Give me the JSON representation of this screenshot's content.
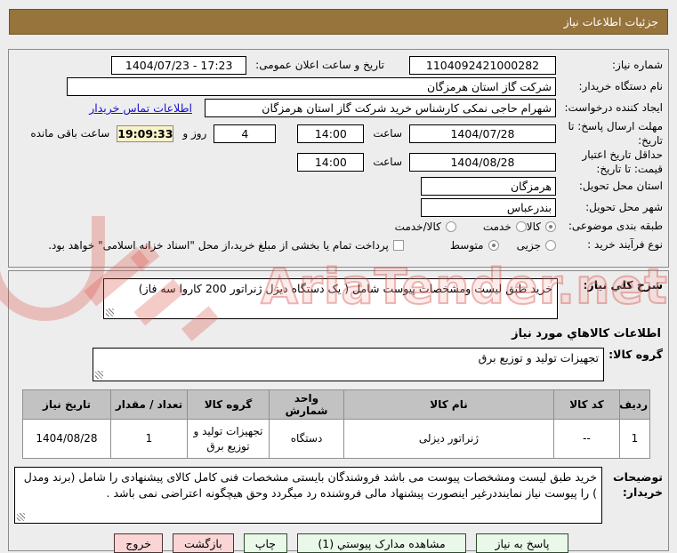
{
  "window": {
    "title": "جزئیات اطلاعات نیاز"
  },
  "watermark": {
    "text": "AriaTender.net"
  },
  "form": {
    "need_number": {
      "label": "شماره نیاز:",
      "value": "1104092421000282"
    },
    "announce": {
      "label": "تاریخ و ساعت اعلان عمومی:",
      "value": "1404/07/23 - 17:23"
    },
    "buyer_org": {
      "label": "نام دستگاه خریدار:",
      "value": "شرکت گاز استان هرمزگان"
    },
    "creator": {
      "label": "ایجاد کننده درخواست:",
      "value": "شهرام حاجی نمکی کارشناس خرید شرکت گاز استان هرمزگان",
      "contact_link": "اطلاعات تماس خریدار"
    },
    "deadline": {
      "label": "مهلت ارسال پاسخ: تا تاریخ:",
      "date": "1404/07/28",
      "hour_label": "ساعت",
      "time": "14:00",
      "days": "4",
      "days_label": "روز و",
      "countdown": "19:09:33",
      "remaining_label": "ساعت باقی مانده"
    },
    "price_validity": {
      "label": "حداقل تاریخ اعتبار قیمت: تا تاریخ:",
      "date": "1404/08/28",
      "hour_label": "ساعت",
      "time": "14:00"
    },
    "province": {
      "label": "استان محل تحویل:",
      "value": "هرمزگان"
    },
    "city": {
      "label": "شهر محل تحویل:",
      "value": "بندرعباس"
    },
    "subject_class": {
      "label": "طبقه بندی موضوعی:",
      "options": [
        {
          "label": "کالا",
          "selected": true
        },
        {
          "label": "خدمت",
          "selected": false
        },
        {
          "label": "کالا/خدمت",
          "selected": false
        }
      ]
    },
    "process": {
      "label": "نوع فرآیند خرید :",
      "options": [
        {
          "label": "جزیی",
          "selected": false
        },
        {
          "label": "متوسط",
          "selected": true
        }
      ],
      "treasury_note": "پرداخت تمام یا بخشی از مبلغ خرید،از محل \"اسناد خزانه اسلامی\" خواهد بود.",
      "treasury_checked": false
    }
  },
  "description": {
    "label": "شرح کلي نیاز:",
    "value": "خرید طبق لیست ومشخصات پیوست شامل ( یک دستگاه دیزل ژنراتور 200 کاروا سه فاز)"
  },
  "goods": {
    "section_title": "اطلاعات کالاهاي مورد نیاز",
    "group_label": "گروه کالا:",
    "group_value": "تجهیزات تولید و توزیع برق",
    "table": {
      "headers": [
        "ردیف",
        "کد کالا",
        "نام کالا",
        "واحد شمارش",
        "گروه کالا",
        "تعداد / مقدار",
        "تاریخ نیاز"
      ],
      "rows": [
        [
          "1",
          "--",
          "ژنراتور دیزلی",
          "دستگاه",
          "تجهیزات تولید و توزیع برق",
          "1",
          "1404/08/28"
        ]
      ]
    }
  },
  "notes": {
    "label": "توضیحات خریدار:",
    "value": "خرید طبق لیست ومشخصات پیوست می باشد فروشندگان بایستی مشخصات فنی کامل کالای پیشنهادی را شامل (برند ومدل ) را پیوست نیاز نماینددرغیر اینصورت پیشنهاد مالی فروشنده رد میگردد وحق هیچگونه اعتراضی نمی باشد ."
  },
  "buttons": {
    "respond": "پاسخ به نیاز",
    "view_docs": "مشاهده مدارک پیوستي (1)",
    "print": "چاپ",
    "back": "بازگشت",
    "exit": "خروج"
  },
  "colors": {
    "header_bg": "#97743C",
    "countdown_bg": "#F8F2C8",
    "link": "#1A0DCC",
    "table_header_bg": "#C2C2C2",
    "button_green_bg": "#E9F8E9",
    "button_pink_bg": "#FBD5D5",
    "watermark": "#DD4A41"
  }
}
